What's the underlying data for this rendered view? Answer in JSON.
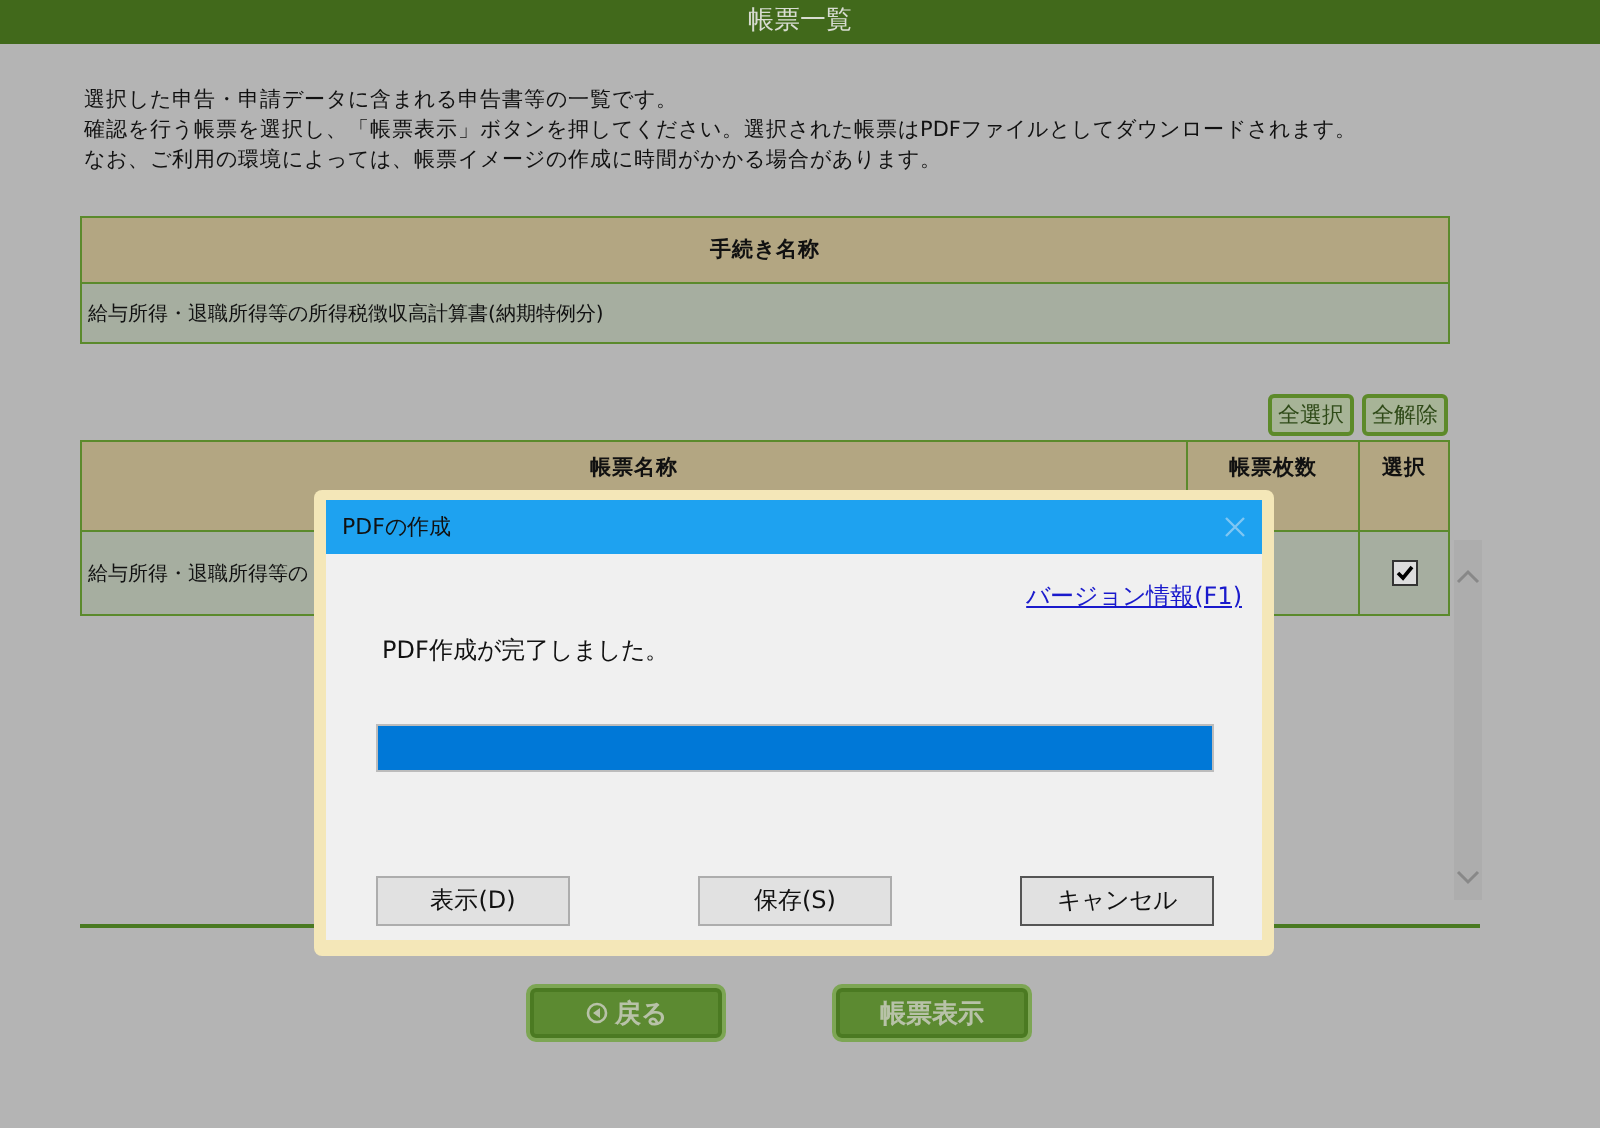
{
  "window": {
    "title": "帳票一覧"
  },
  "intro": [
    "選択した申告・申請データに含まれる申告書等の一覧です。",
    "確認を行う帳票を選択し、「帳票表示」ボタンを押してください。選択された帳票はPDFファイルとしてダウンロードされます。",
    "なお、ご利用の環境によっては、帳票イメージの作成に時間がかかる場合があります。"
  ],
  "procedures": {
    "columns": [
      "手続き名称"
    ],
    "rows": [
      "給与所得・退職所得等の所得税徴収高計算書(納期特例分)"
    ]
  },
  "selection_buttons": [
    "全選択",
    "全解除"
  ],
  "forms": {
    "columns": [
      "帳票名称",
      "帳票枚数",
      "選択"
    ],
    "rows": [
      {
        "name": "給与所得・退職所得等の",
        "checked": true
      }
    ]
  },
  "footer_buttons": [
    {
      "label": "戻る",
      "kind": "back"
    },
    {
      "label": "帳票表示",
      "kind": "plain"
    }
  ],
  "dialog": {
    "title": "PDFの作成",
    "link": "バージョン情報(F1)",
    "message": "PDF作成が完了しました。",
    "progress": {
      "level": 1
    },
    "buttons": [
      "表示(D)",
      "保存(S)",
      "キャンセル"
    ]
  }
}
